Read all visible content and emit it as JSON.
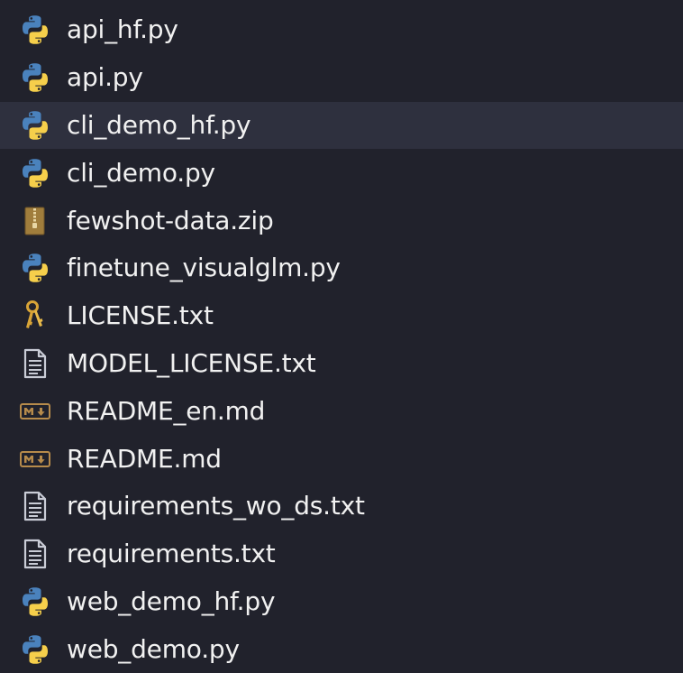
{
  "explorer": {
    "files": [
      {
        "name": "api_hf.py",
        "icon": "python-icon",
        "selected": false
      },
      {
        "name": "api.py",
        "icon": "python-icon",
        "selected": false
      },
      {
        "name": "cli_demo_hf.py",
        "icon": "python-icon",
        "selected": true
      },
      {
        "name": "cli_demo.py",
        "icon": "python-icon",
        "selected": false
      },
      {
        "name": "fewshot-data.zip",
        "icon": "zip-icon",
        "selected": false
      },
      {
        "name": "finetune_visualglm.py",
        "icon": "python-icon",
        "selected": false
      },
      {
        "name": "LICENSE.txt",
        "icon": "license-key-icon",
        "selected": false
      },
      {
        "name": "MODEL_LICENSE.txt",
        "icon": "text-file-icon",
        "selected": false
      },
      {
        "name": "README_en.md",
        "icon": "markdown-icon",
        "selected": false
      },
      {
        "name": "README.md",
        "icon": "markdown-icon",
        "selected": false
      },
      {
        "name": "requirements_wo_ds.txt",
        "icon": "text-file-icon",
        "selected": false
      },
      {
        "name": "requirements.txt",
        "icon": "text-file-icon",
        "selected": false
      },
      {
        "name": "web_demo_hf.py",
        "icon": "python-icon",
        "selected": false
      },
      {
        "name": "web_demo.py",
        "icon": "python-icon",
        "selected": false
      }
    ]
  },
  "colors": {
    "background": "#21222c",
    "selected_row": "#2e303e",
    "text": "#f1f1f1",
    "python_blue": "#4a82bd",
    "python_yellow": "#f6cf4b",
    "zip_brown": "#a07d3c",
    "license_gold": "#d8a437",
    "text_icon_gray": "#c9ccd6",
    "markdown_brown": "#b78b4b"
  }
}
